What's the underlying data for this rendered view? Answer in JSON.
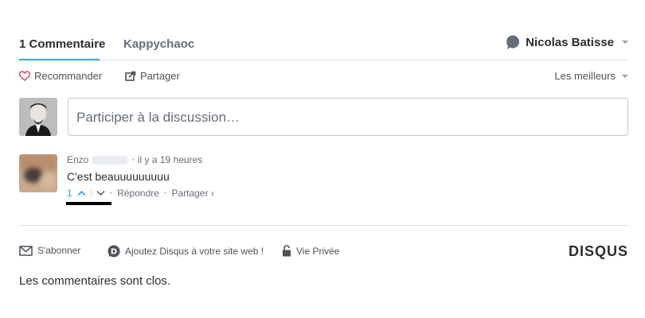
{
  "tabs": {
    "comments_tab": "1 Commentaire",
    "community_tab": "Kappychaoc",
    "user_name": "Nicolas Batisse"
  },
  "actions": {
    "recommend": "Recommander",
    "share": "Partager",
    "sort": "Les meilleurs"
  },
  "composer": {
    "placeholder": "Participer à la discussion…"
  },
  "comment": {
    "author": "Enzo",
    "time": "il y a 19 heures",
    "text": "C'est beauuuuuuuuu",
    "votes": "1",
    "reply": "Répondre",
    "share": "Partager ›"
  },
  "bottom": {
    "subscribe": "S'abonner",
    "add_disqus": "Ajoutez Disqus à votre site web !",
    "privacy": "Vie Privée",
    "logo": "DISQUS"
  },
  "closed_text": "Les commentaires sont clos.",
  "colors": {
    "accent": "#2e9fff",
    "text": "#2a2e2e",
    "muted": "#656c7a",
    "border": "#dbdfe4"
  },
  "icons": [
    "speech-bubble-icon",
    "heart-icon",
    "share-icon",
    "chevron-up-icon",
    "chevron-down-icon",
    "envelope-icon",
    "disqus-d-icon",
    "lock-icon"
  ]
}
